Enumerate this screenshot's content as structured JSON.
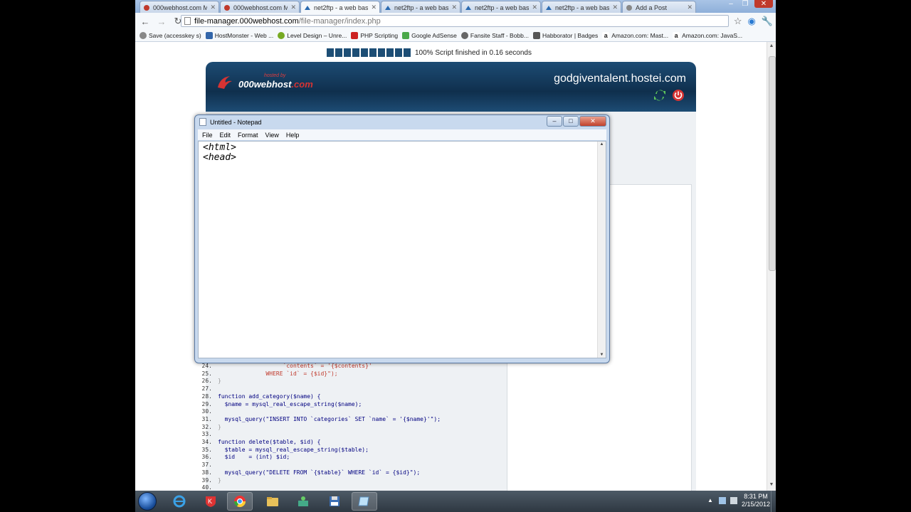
{
  "browser": {
    "tabs": [
      {
        "title": "000webhost.com Me",
        "active": false
      },
      {
        "title": "000webhost.com Me",
        "active": false
      },
      {
        "title": "net2ftp - a web base",
        "active": true
      },
      {
        "title": "net2ftp - a web base",
        "active": false
      },
      {
        "title": "net2ftp - a web base",
        "active": false
      },
      {
        "title": "net2ftp - a web base",
        "active": false
      },
      {
        "title": "Add a Post",
        "active": false
      }
    ],
    "url_host": "file-manager.000webhost.com",
    "url_path": "/file-manager/index.php",
    "bookmarks": [
      {
        "label": "Save (accesskey s)",
        "color": "#888888"
      },
      {
        "label": "HostMonster - Web ...",
        "color": "#3366aa"
      },
      {
        "label": "Level Design – Unre...",
        "color": "#77aa22"
      },
      {
        "label": "PHP Scripting",
        "color": "#cc2222"
      },
      {
        "label": "Google AdSense",
        "color": "#4aa84a"
      },
      {
        "label": "Fansite Staff - Bobb...",
        "color": "#666666"
      },
      {
        "label": "Habborator | Badges",
        "color": "#555555"
      },
      {
        "label": "Amazon.com: Mast...",
        "color": "#222222"
      },
      {
        "label": "Amazon.com: JavaS...",
        "color": "#222222"
      }
    ]
  },
  "page": {
    "progress_text": "100% Script finished in 0.16 seconds",
    "logo_sub": "hosted by",
    "logo_text": "000webhost",
    "logo_dot": ".com",
    "site_name": "godgiventalent.hostei.com",
    "code_lines": [
      {
        "num": "24.",
        "text": "                   `contents` = '{$contents}'"
      },
      {
        "num": "25.",
        "text": "              WHERE `id` = {$id}\");"
      },
      {
        "num": "26.",
        "text": "}"
      },
      {
        "num": "27.",
        "text": ""
      },
      {
        "num": "28.",
        "text": "function add_category($name) {"
      },
      {
        "num": "29.",
        "text": "  $name = mysql_real_escape_string($name);"
      },
      {
        "num": "30.",
        "text": ""
      },
      {
        "num": "31.",
        "text": "  mysql_query(\"INSERT INTO `categories` SET `name` = '{$name}'\");"
      },
      {
        "num": "32.",
        "text": "}"
      },
      {
        "num": "33.",
        "text": ""
      },
      {
        "num": "34.",
        "text": "function delete($table, $id) {"
      },
      {
        "num": "35.",
        "text": "  $table = mysql_real_escape_string($table);"
      },
      {
        "num": "36.",
        "text": "  $id    = (int) $id;"
      },
      {
        "num": "37.",
        "text": ""
      },
      {
        "num": "38.",
        "text": "  mysql_query(\"DELETE FROM `{$table}` WHERE `id` = {$id}\");"
      },
      {
        "num": "39.",
        "text": "}"
      },
      {
        "num": "40.",
        "text": ""
      }
    ]
  },
  "notepad": {
    "title": "Untitled - Notepad",
    "menu": [
      "File",
      "Edit",
      "Format",
      "View",
      "Help"
    ],
    "lines": [
      "<html>",
      "<head>"
    ]
  },
  "taskbar": {
    "time": "8:31 PM",
    "date": "2/15/2012"
  },
  "colors": {
    "banner": "#1d4c74",
    "progress": "#1d4e75",
    "accent_red": "#d63333"
  }
}
